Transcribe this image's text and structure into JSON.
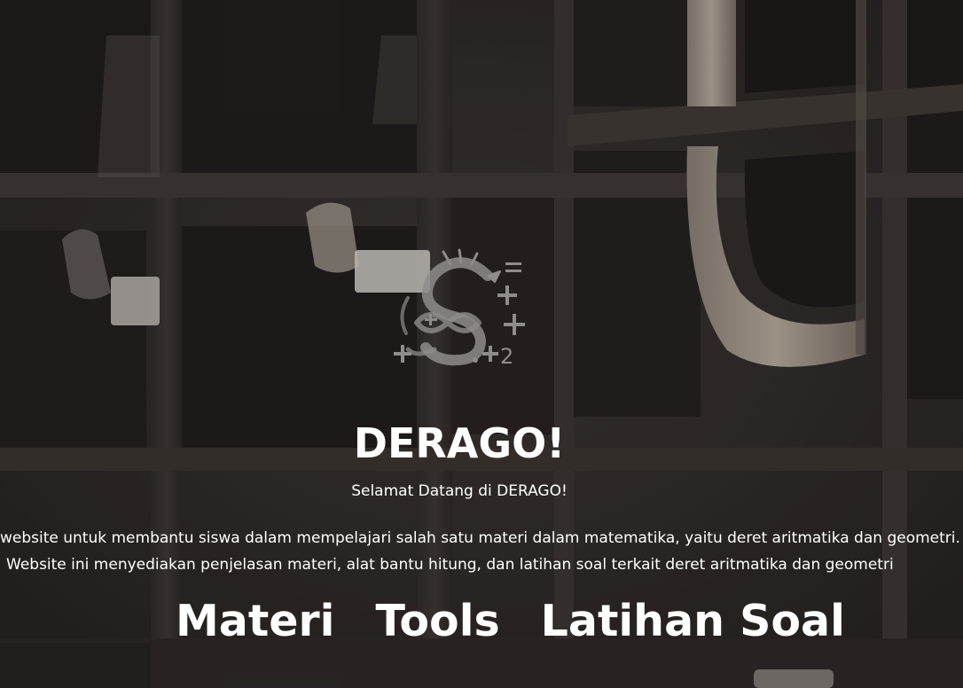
{
  "hero": {
    "title": "DERAGO!",
    "subtitle": "Selamat Datang di DERAGO!",
    "description_line1": "website untuk membantu siswa dalam mempelajari salah satu materi dalam matematika, yaitu deret aritmatika dan geometri.",
    "description_line2": "Website ini menyediakan penjelasan materi, alat bantu hitung, dan latihan soal terkait deret aritmatika dan geometri"
  },
  "logo": {
    "icon": "dragon-math-logo-icon",
    "symbols": [
      "=",
      "+",
      "+",
      "+",
      "+",
      "+2"
    ]
  },
  "nav": {
    "items": [
      "Materi",
      "Tools",
      "Latihan Soal"
    ]
  },
  "colors": {
    "text": "#ffffff",
    "background_dark": "#2a2624",
    "logo_gray": "#8f8c8a"
  }
}
